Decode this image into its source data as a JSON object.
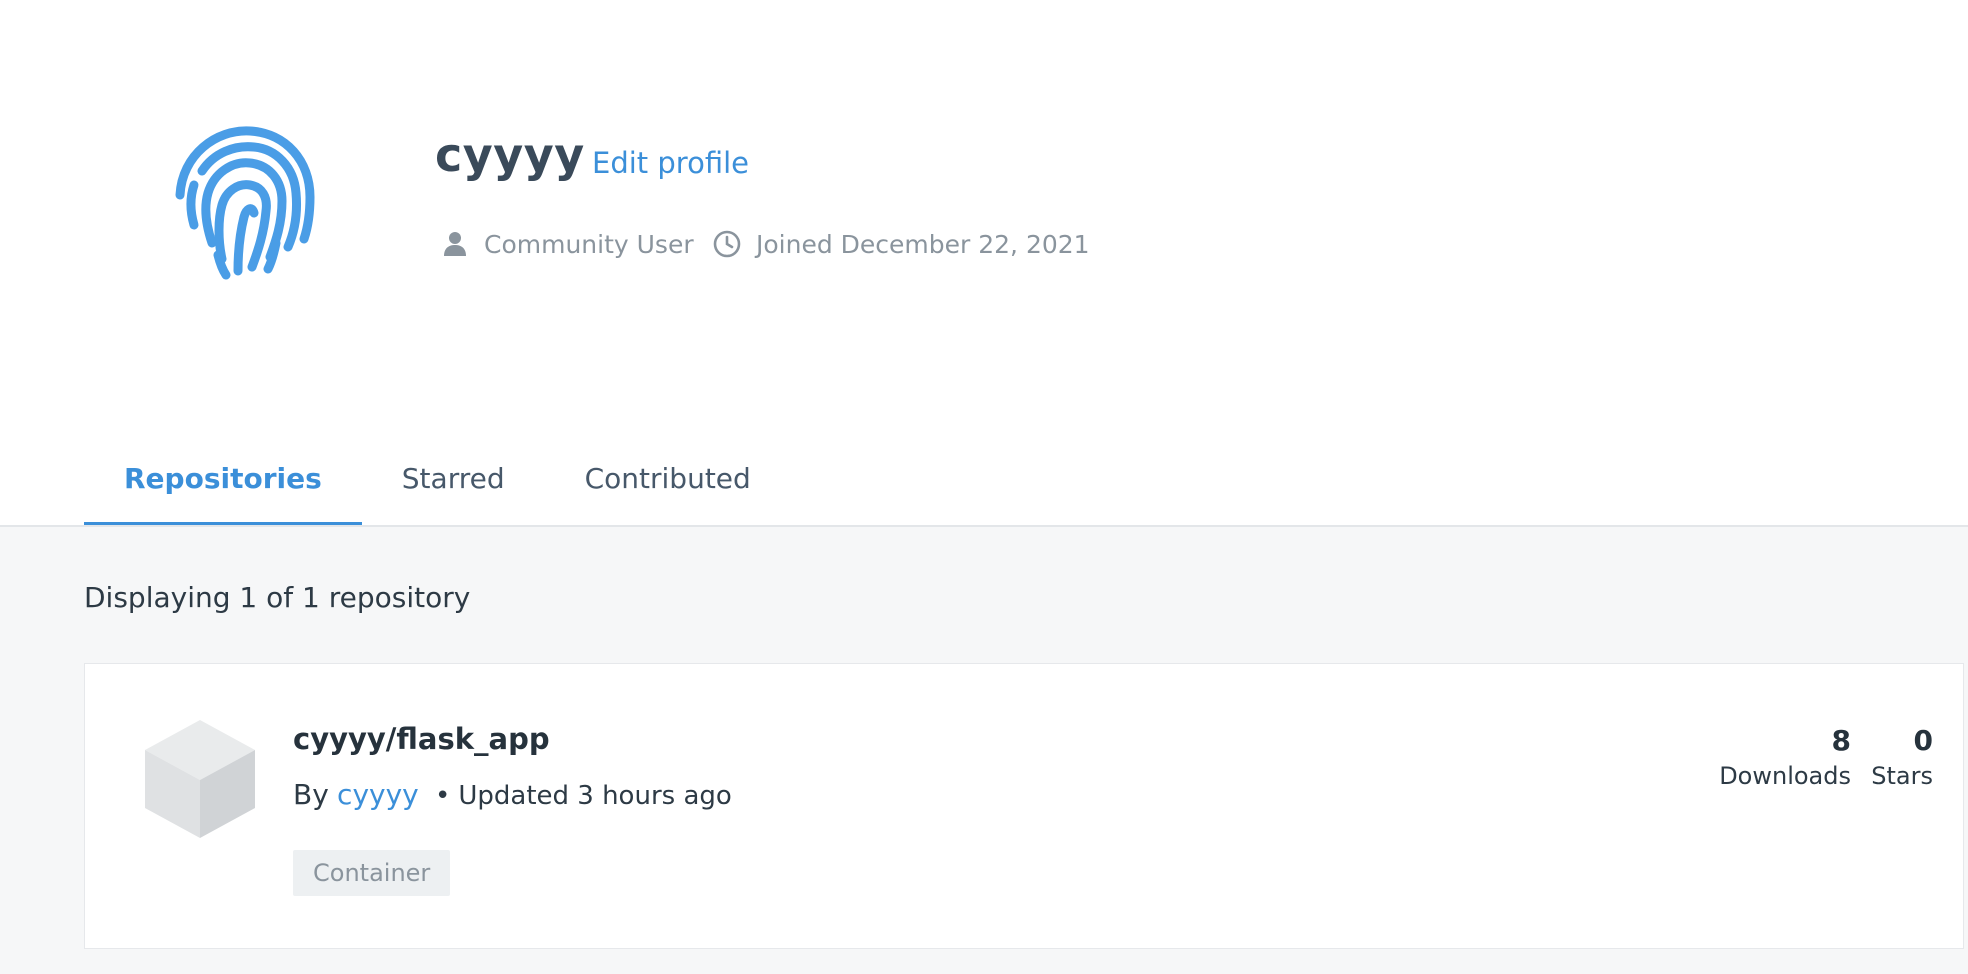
{
  "profile": {
    "username": "cyyyy",
    "edit_label": "Edit profile",
    "role": "Community User",
    "joined": "Joined December 22, 2021",
    "avatar_icon": "fingerprint-icon",
    "role_icon": "user-icon",
    "joined_icon": "clock-icon"
  },
  "tabs": [
    {
      "label": "Repositories",
      "active": true
    },
    {
      "label": "Starred",
      "active": false
    },
    {
      "label": "Contributed",
      "active": false
    }
  ],
  "content": {
    "count_text": "Displaying 1 of 1 repository"
  },
  "repositories": [
    {
      "name": "cyyyy/flask_app",
      "by_label": "By",
      "author": "cyyyy",
      "separator": "•",
      "updated": "Updated 3 hours ago",
      "tag": "Container",
      "icon": "cube-icon",
      "downloads": "8",
      "downloads_label": "Downloads",
      "stars": "0",
      "stars_label": "Stars"
    }
  ],
  "colors": {
    "accent": "#3b8fd9",
    "text_dark": "#2d3a45",
    "text_muted": "#8a949d",
    "content_bg": "#f6f7f8"
  }
}
